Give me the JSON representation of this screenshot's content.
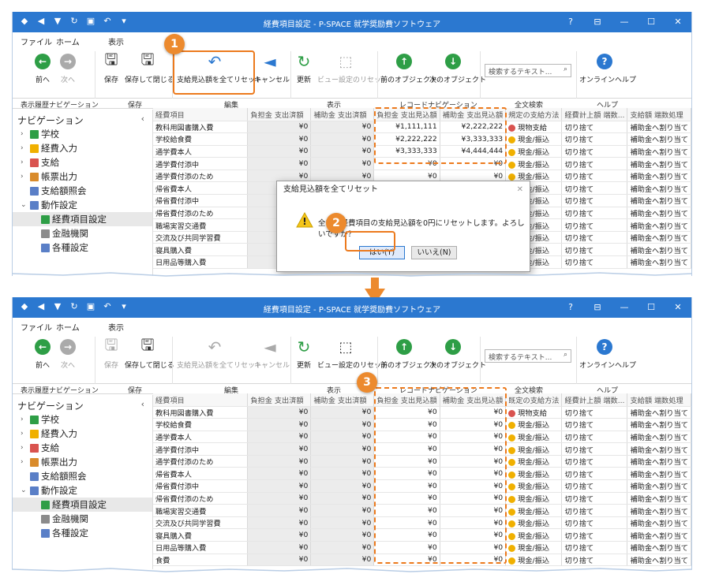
{
  "window": {
    "title": "経費項目設定 - P-SPACE 就学奨励費ソフトウェア"
  },
  "menu": {
    "file": "ファイル",
    "home": "ホーム",
    "view": "表示"
  },
  "ribbon": {
    "back": "前へ",
    "forward": "次へ",
    "save": "保存",
    "save_close": "保存して閉じる",
    "reset_all": "支給見込額を全てリセット",
    "cancel": "キャンセル",
    "refresh": "更新",
    "view_reset": "ビュー設定のリセット",
    "prev_obj": "前のオブジェクト",
    "next_obj": "次のオブジェクト",
    "search_placeholder": "検索するテキスト...",
    "online_help": "オンラインヘルプ"
  },
  "groups": {
    "history": "表示履歴ナビゲーション",
    "save": "保存",
    "edit": "編集",
    "view": "表示",
    "record_nav": "レコードナビゲーション",
    "fulltext": "全文検索",
    "help": "ヘルプ"
  },
  "nav": {
    "title": "ナビゲーション",
    "items": [
      {
        "label": "学校"
      },
      {
        "label": "経費入力"
      },
      {
        "label": "支給"
      },
      {
        "label": "帳票出力"
      },
      {
        "label": "支給額照会"
      },
      {
        "label": "動作設定"
      },
      {
        "label": "経費項目設定"
      },
      {
        "label": "金融機関"
      },
      {
        "label": "各種設定"
      }
    ]
  },
  "columns": [
    "経費項目",
    "負担金 支出済額",
    "補助金 支出済額",
    "負担金 支出見込額",
    "補助金 支出見込額",
    "既定の支給方法",
    "経費計上額 端数...",
    "支給額 端数処理"
  ],
  "columns_cut": [
    "経費項目",
    "負担金 支出済額",
    "補助金 支出済額",
    "負担金 支出見込額",
    "補助金 支出見込額",
    "規定の支給方法",
    "経費計上額 端数...",
    "支給額 端数処理"
  ],
  "rows1": [
    [
      "教科用図書購入費",
      "¥0",
      "¥0",
      "¥1,111,111",
      "¥2,222,222",
      "現物支給",
      "切り捨て",
      "補助金へ割り当て"
    ],
    [
      "学校給食費",
      "¥0",
      "¥0",
      "¥2,222,222",
      "¥3,333,333",
      "現金/振込",
      "切り捨て",
      "補助金へ割り当て"
    ],
    [
      "通学費本人",
      "¥0",
      "¥0",
      "¥3,333,333",
      "¥4,444,444",
      "現金/振込",
      "切り捨て",
      "補助金へ割り当て"
    ],
    [
      "通学費付添中",
      "¥0",
      "¥0",
      "¥0",
      "¥0",
      "現金/振込",
      "切り捨て",
      "補助金へ割り当て"
    ],
    [
      "通学費付添のため",
      "¥0",
      "¥0",
      "¥0",
      "¥0",
      "現金/振込",
      "切り捨て",
      "補助金へ割り当て"
    ],
    [
      "帰省費本人",
      "¥0",
      "¥0",
      "¥0",
      "¥0",
      "現金/振込",
      "切り捨て",
      "補助金へ割り当て"
    ],
    [
      "帰省費付添中",
      "¥0",
      "¥0",
      "¥0",
      "¥0",
      "現金/振込",
      "切り捨て",
      "補助金へ割り当て"
    ],
    [
      "帰省費付添のため",
      "¥0",
      "¥0",
      "¥0",
      "¥0",
      "現金/振込",
      "切り捨て",
      "補助金へ割り当て"
    ],
    [
      "職場実習交通費",
      "¥0",
      "¥0",
      "¥0",
      "¥0",
      "現金/振込",
      "切り捨て",
      "補助金へ割り当て"
    ],
    [
      "交流及び共同学習費",
      "¥0",
      "¥0",
      "¥0",
      "¥0",
      "現金/振込",
      "切り捨て",
      "補助金へ割り当て"
    ],
    [
      "寝具購入費",
      "¥0",
      "¥0",
      "¥0",
      "¥0",
      "現金/振込",
      "切り捨て",
      "補助金へ割り当て"
    ],
    [
      "日用品等購入費",
      "¥0",
      "¥0",
      "¥0",
      "¥0",
      "現金/振込",
      "切り捨て",
      "補助金へ割り当て"
    ]
  ],
  "rows2": [
    [
      "教科用図書購入費",
      "¥0",
      "¥0",
      "¥0",
      "¥0",
      "現物支給",
      "切り捨て",
      "補助金へ割り当て"
    ],
    [
      "学校給食費",
      "¥0",
      "¥0",
      "¥0",
      "¥0",
      "現金/振込",
      "切り捨て",
      "補助金へ割り当て"
    ],
    [
      "通学費本人",
      "¥0",
      "¥0",
      "¥0",
      "¥0",
      "現金/振込",
      "切り捨て",
      "補助金へ割り当て"
    ],
    [
      "通学費付添中",
      "¥0",
      "¥0",
      "¥0",
      "¥0",
      "現金/振込",
      "切り捨て",
      "補助金へ割り当て"
    ],
    [
      "通学費付添のため",
      "¥0",
      "¥0",
      "¥0",
      "¥0",
      "現金/振込",
      "切り捨て",
      "補助金へ割り当て"
    ],
    [
      "帰省費本人",
      "¥0",
      "¥0",
      "¥0",
      "¥0",
      "現金/振込",
      "切り捨て",
      "補助金へ割り当て"
    ],
    [
      "帰省費付添中",
      "¥0",
      "¥0",
      "¥0",
      "¥0",
      "現金/振込",
      "切り捨て",
      "補助金へ割り当て"
    ],
    [
      "帰省費付添のため",
      "¥0",
      "¥0",
      "¥0",
      "¥0",
      "現金/振込",
      "切り捨て",
      "補助金へ割り当て"
    ],
    [
      "職場実習交通費",
      "¥0",
      "¥0",
      "¥0",
      "¥0",
      "現金/振込",
      "切り捨て",
      "補助金へ割り当て"
    ],
    [
      "交流及び共同学習費",
      "¥0",
      "¥0",
      "¥0",
      "¥0",
      "現金/振込",
      "切り捨て",
      "補助金へ割り当て"
    ],
    [
      "寝具購入費",
      "¥0",
      "¥0",
      "¥0",
      "¥0",
      "現金/振込",
      "切り捨て",
      "補助金へ割り当て"
    ],
    [
      "日用品等購入費",
      "¥0",
      "¥0",
      "¥0",
      "¥0",
      "現金/振込",
      "切り捨て",
      "補助金へ割り当て"
    ],
    [
      "食費",
      "¥0",
      "¥0",
      "¥0",
      "¥0",
      "現金/振込",
      "切り捨て",
      "補助金へ割り当て"
    ]
  ],
  "dialog": {
    "title": "支給見込額を全てリセット",
    "message": "全ての経費項目の支給見込額を0円にリセットします。よろしいですか？",
    "yes": "はい(Y)",
    "no": "いいえ(N)"
  },
  "badges": {
    "b1": "1",
    "b2": "2",
    "b3": "3"
  },
  "colors": {
    "titlebar": "#2b78d0",
    "highlight": "#ec7a1d",
    "green": "#2e9e46",
    "blue_arrow": "#2b78d0"
  }
}
